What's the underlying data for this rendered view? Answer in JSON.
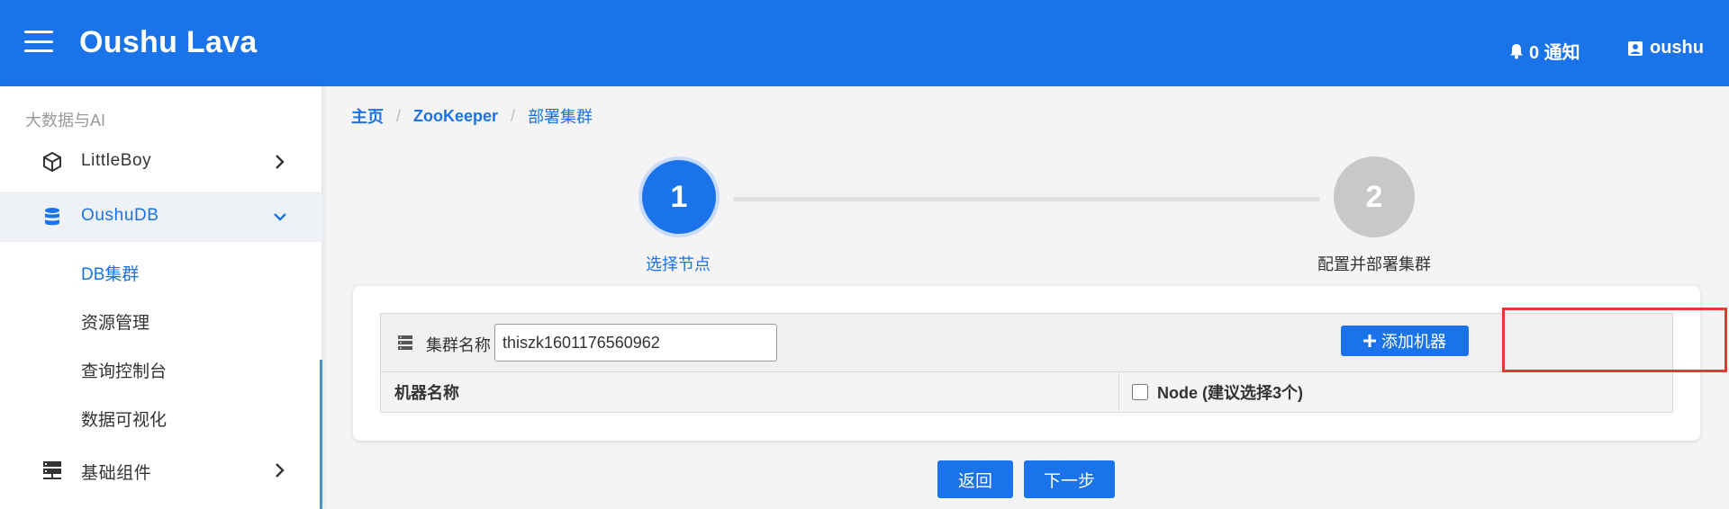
{
  "header": {
    "app_title": "Oushu Lava",
    "notifications_label": "0 通知",
    "user_label": "oushu",
    "color": "#1a73e8"
  },
  "sidebar": {
    "section_label": "大数据与AI",
    "items": [
      {
        "label": "LittleBoy",
        "icon": "cube-icon",
        "expanded": false
      },
      {
        "label": "OushuDB",
        "icon": "database-icon",
        "expanded": true,
        "children": [
          {
            "label": "DB集群",
            "active": true
          },
          {
            "label": "资源管理"
          },
          {
            "label": "查询控制台"
          },
          {
            "label": "数据可视化"
          }
        ]
      },
      {
        "label": "基础组件",
        "icon": "server-icon",
        "expanded": false
      }
    ]
  },
  "breadcrumb": [
    "主页",
    "ZooKeeper",
    "部署集群"
  ],
  "steps": [
    {
      "number": "1",
      "label": "选择节点",
      "active": true
    },
    {
      "number": "2",
      "label": "配置并部署集群",
      "active": false
    }
  ],
  "form": {
    "cluster_name_label": "集群名称",
    "cluster_name_value": "thiszk1601176560962",
    "add_machine_label": "添加机器",
    "table_headers": {
      "machine_name": "机器名称",
      "node": "Node (建议选择3个)"
    }
  },
  "actions": {
    "back_label": "返回",
    "next_label": "下一步"
  }
}
